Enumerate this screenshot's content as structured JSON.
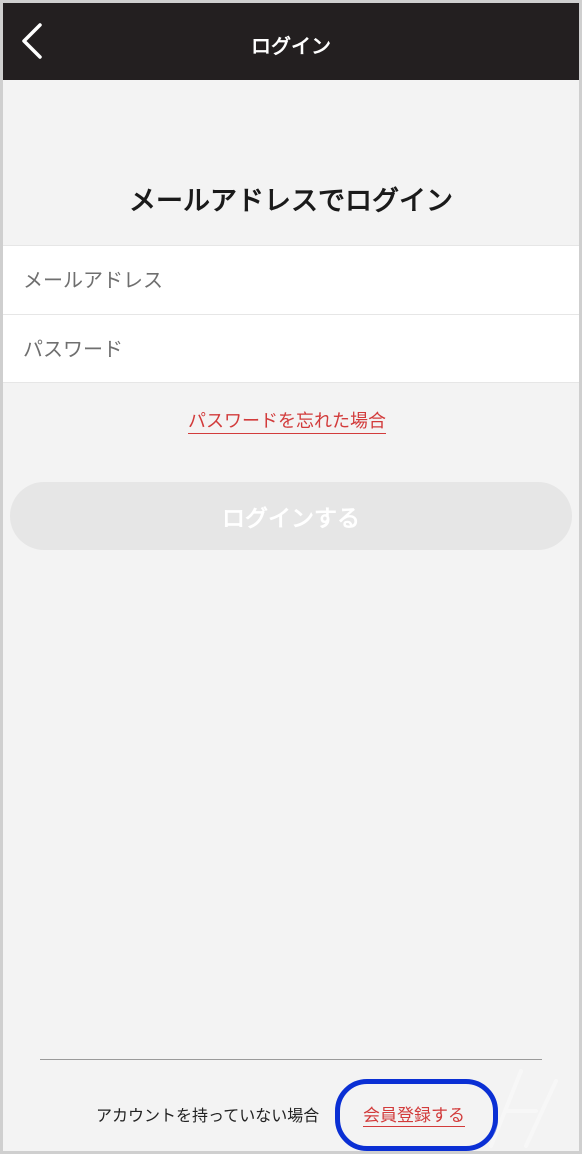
{
  "header": {
    "title": "ログイン",
    "back_icon": "chevron-left-icon"
  },
  "main": {
    "section_title": "メールアドレスでログイン",
    "email_placeholder": "メールアドレス",
    "password_placeholder": "パスワード",
    "forgot_password": "パスワードを忘れた場合",
    "login_button": "ログインする"
  },
  "footer": {
    "no_account_text": "アカウントを持っていない場合",
    "register_link": "会員登録する"
  },
  "colors": {
    "header_bg": "#231f20",
    "link_red": "#d23b3b",
    "highlight_blue": "#0a2fd4",
    "button_disabled": "#e6e6e6"
  }
}
